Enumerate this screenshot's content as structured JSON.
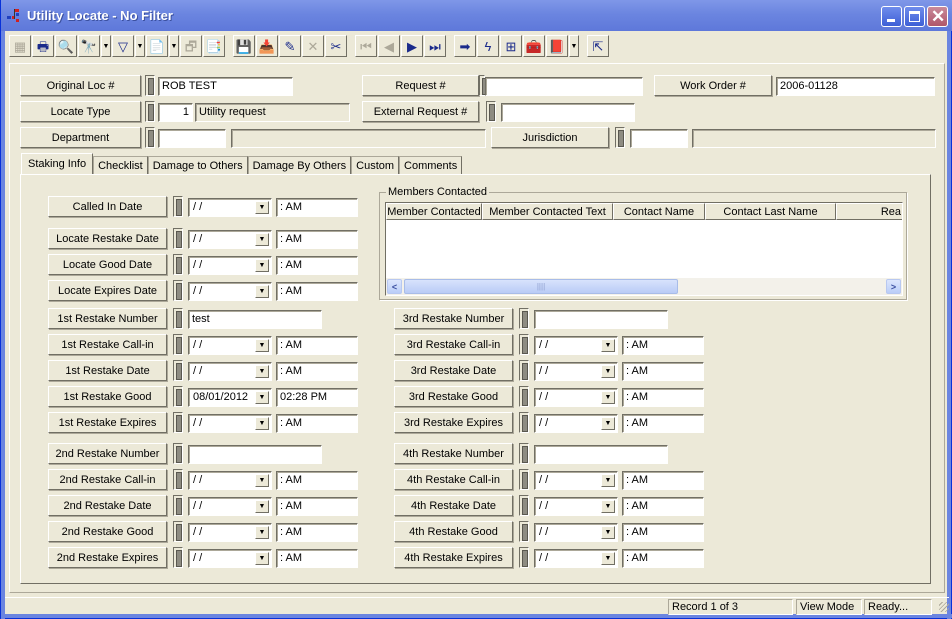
{
  "window": {
    "title": "Utility Locate - No Filter",
    "controls": {
      "minimize": "minimize",
      "maximize": "maximize",
      "close": "close"
    }
  },
  "toolbar": {
    "buttons": [
      {
        "name": "form-view-icon",
        "glyph": "▦",
        "enabled": false
      },
      {
        "name": "print-icon",
        "glyph": "🖶",
        "enabled": true
      },
      {
        "name": "print-preview-icon",
        "glyph": "🔍",
        "enabled": true
      },
      {
        "name": "find-icon",
        "glyph": "🔭",
        "enabled": true,
        "dropdown": true
      },
      {
        "name": "filter-icon",
        "glyph": "▽",
        "enabled": true,
        "dropdown": true
      },
      {
        "name": "report-icon",
        "glyph": "📄",
        "enabled": true,
        "dropdown": true
      },
      {
        "name": "export-icon",
        "glyph": "🗗",
        "enabled": false
      },
      {
        "name": "copy-document-icon",
        "glyph": "📑",
        "enabled": true
      },
      {
        "name": "save-icon",
        "glyph": "💾",
        "enabled": false
      },
      {
        "name": "add-record-icon",
        "glyph": "📥",
        "enabled": true
      },
      {
        "name": "edit-pencil-icon",
        "glyph": "✎",
        "enabled": true
      },
      {
        "name": "delete-icon",
        "glyph": "✕",
        "enabled": false
      },
      {
        "name": "cut-icon",
        "glyph": "✂",
        "enabled": true
      },
      {
        "name": "first-record-icon",
        "glyph": "⏮",
        "enabled": false
      },
      {
        "name": "previous-record-icon",
        "glyph": "◀",
        "enabled": false
      },
      {
        "name": "next-record-icon",
        "glyph": "▶",
        "enabled": true
      },
      {
        "name": "last-record-icon",
        "glyph": "⏭",
        "enabled": true
      },
      {
        "name": "goto-arrow-icon",
        "glyph": "➡",
        "enabled": true
      },
      {
        "name": "lightning-icon",
        "glyph": "ϟ",
        "enabled": true
      },
      {
        "name": "hierarchy-icon",
        "glyph": "⊞",
        "enabled": true
      },
      {
        "name": "toolbox-icon",
        "glyph": "🧰",
        "enabled": true
      },
      {
        "name": "help-book-icon",
        "glyph": "📕",
        "enabled": true,
        "dropdown": true
      },
      {
        "name": "exit-icon",
        "glyph": "⇱",
        "enabled": true
      }
    ]
  },
  "header": {
    "original_loc": {
      "label": "Original Loc #",
      "value": "ROB TEST"
    },
    "request": {
      "label": "Request #",
      "value": ""
    },
    "work_order": {
      "label": "Work Order #",
      "value": "2006-01128"
    },
    "locate_type": {
      "label": "Locate Type",
      "code": "1",
      "description": "Utility request"
    },
    "external_request": {
      "label": "External Request #",
      "value": ""
    },
    "department": {
      "label": "Department",
      "code": "",
      "description": ""
    },
    "jurisdiction": {
      "label": "Jurisdiction",
      "code": "",
      "description": ""
    }
  },
  "tabs": [
    {
      "label": "Staking Info",
      "active": true
    },
    {
      "label": "Checklist",
      "active": false
    },
    {
      "label": "Damage to Others",
      "active": false
    },
    {
      "label": "Damage By Others",
      "active": false
    },
    {
      "label": "Custom",
      "active": false
    },
    {
      "label": "Comments",
      "active": false
    }
  ],
  "staking": {
    "called_in": {
      "label": "Called In Date",
      "date": " / /",
      "time": " :  AM"
    },
    "locate_restake": {
      "label": "Locate Restake Date",
      "date": " / /",
      "time": " :  AM"
    },
    "locate_good": {
      "label": "Locate Good Date",
      "date": " / /",
      "time": " :  AM"
    },
    "locate_expires": {
      "label": "Locate Expires Date",
      "date": " / /",
      "time": " :  AM"
    },
    "r1_number": {
      "label": "1st Restake Number",
      "value": "test"
    },
    "r1_callin": {
      "label": "1st Restake Call-in",
      "date": " / /",
      "time": " :  AM"
    },
    "r1_date": {
      "label": "1st Restake Date",
      "date": " / /",
      "time": " :  AM"
    },
    "r1_good": {
      "label": "1st Restake Good",
      "date": "08/01/2012",
      "time": "02:28 PM"
    },
    "r1_expires": {
      "label": "1st Restake Expires",
      "date": " / /",
      "time": " :  AM"
    },
    "r2_number": {
      "label": "2nd Restake Number",
      "value": ""
    },
    "r2_callin": {
      "label": "2nd Restake Call-in",
      "date": " / /",
      "time": " :  AM"
    },
    "r2_date": {
      "label": "2nd Restake Date",
      "date": " / /",
      "time": " :  AM"
    },
    "r2_good": {
      "label": "2nd Restake Good",
      "date": " / /",
      "time": " :  AM"
    },
    "r2_expires": {
      "label": "2nd Restake Expires",
      "date": " / /",
      "time": " :  AM"
    },
    "r3_number": {
      "label": "3rd Restake Number",
      "value": ""
    },
    "r3_callin": {
      "label": "3rd Restake Call-in",
      "date": " / /",
      "time": " :  AM"
    },
    "r3_date": {
      "label": "3rd Restake Date",
      "date": " / /",
      "time": " :  AM"
    },
    "r3_good": {
      "label": "3rd Restake Good",
      "date": " / /",
      "time": " :  AM"
    },
    "r3_expires": {
      "label": "3rd Restake Expires",
      "date": " / /",
      "time": " :  AM"
    },
    "r4_number": {
      "label": "4th Restake Number",
      "value": ""
    },
    "r4_callin": {
      "label": "4th Restake Call-in",
      "date": " / /",
      "time": " :  AM"
    },
    "r4_date": {
      "label": "4th Restake Date",
      "date": " / /",
      "time": " :  AM"
    },
    "r4_good": {
      "label": "4th Restake Good",
      "date": " / /",
      "time": " :  AM"
    },
    "r4_expires": {
      "label": "4th Restake Expires",
      "date": " / /",
      "time": " :  AM"
    }
  },
  "members_contacted": {
    "title": "Members Contacted",
    "columns": [
      "Member Contacted",
      "Member Contacted Text",
      "Contact Name",
      "Contact Last Name",
      "Rea"
    ],
    "rows": []
  },
  "statusbar": {
    "record": "Record 1 of 3",
    "mode": "View Mode",
    "status": "Ready..."
  }
}
